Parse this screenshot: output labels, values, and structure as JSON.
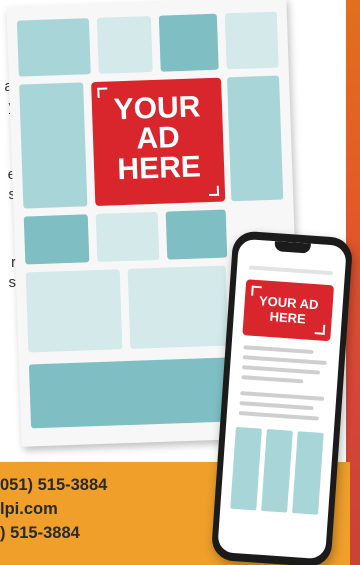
{
  "side_text_fragments": [
    "y",
    "al",
    "y",
    "e",
    "s",
    "r",
    "s"
  ],
  "print_ad": {
    "badge_lines": [
      "YOUR",
      "AD",
      "HERE"
    ]
  },
  "phone_ad": {
    "badge_lines": [
      "YOUR AD",
      "HERE"
    ]
  },
  "contact": {
    "line1": "051) 515-3884",
    "line2": "lpi.com",
    "line3": ") 515-3884"
  },
  "colors": {
    "accent_orange": "#ef9f2a",
    "ad_red": "#d9262c",
    "panel_teal": "#a8d5d7"
  }
}
